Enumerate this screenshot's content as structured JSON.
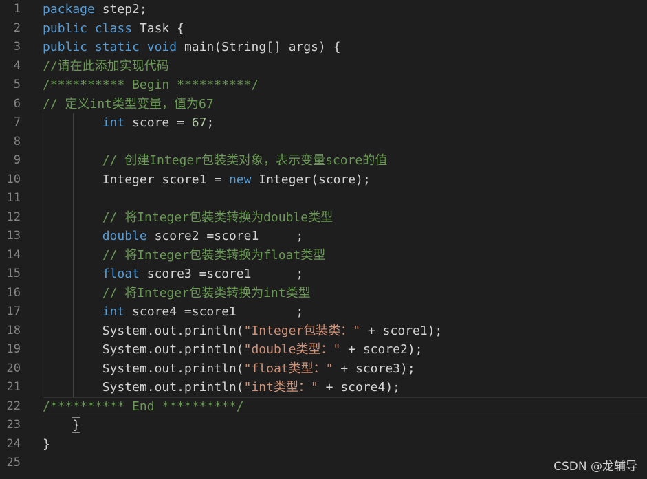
{
  "editor": {
    "lines": [
      {
        "n": "1",
        "segments": [
          {
            "t": "package",
            "c": "kw"
          },
          {
            "t": " step2;",
            "c": ""
          }
        ]
      },
      {
        "n": "2",
        "segments": [
          {
            "t": "public",
            "c": "kw"
          },
          {
            "t": " ",
            "c": ""
          },
          {
            "t": "class",
            "c": "kw"
          },
          {
            "t": " Task {",
            "c": ""
          }
        ]
      },
      {
        "n": "3",
        "segments": [
          {
            "t": "public",
            "c": "kw"
          },
          {
            "t": " ",
            "c": ""
          },
          {
            "t": "static",
            "c": "kw"
          },
          {
            "t": " ",
            "c": ""
          },
          {
            "t": "void",
            "c": "kw"
          },
          {
            "t": " main(String[] args) {",
            "c": ""
          }
        ]
      },
      {
        "n": "4",
        "segments": [
          {
            "t": "//请在此添加实现代码",
            "c": "cm"
          }
        ]
      },
      {
        "n": "5",
        "segments": [
          {
            "t": "/********** Begin **********/",
            "c": "cm"
          }
        ]
      },
      {
        "n": "6",
        "segments": [
          {
            "t": "// 定义int类型变量，值为67",
            "c": "cm"
          }
        ]
      },
      {
        "n": "7",
        "segments": [
          {
            "t": "        ",
            "c": ""
          },
          {
            "t": "int",
            "c": "kw"
          },
          {
            "t": " score = ",
            "c": ""
          },
          {
            "t": "67",
            "c": "num"
          },
          {
            "t": ";",
            "c": ""
          }
        ]
      },
      {
        "n": "8",
        "segments": []
      },
      {
        "n": "9",
        "segments": [
          {
            "t": "        ",
            "c": ""
          },
          {
            "t": "// 创建Integer包装类对象，表示变量score的值",
            "c": "cm"
          }
        ]
      },
      {
        "n": "10",
        "segments": [
          {
            "t": "        Integer score1 = ",
            "c": ""
          },
          {
            "t": "new",
            "c": "kw"
          },
          {
            "t": " Integer(score);",
            "c": ""
          }
        ]
      },
      {
        "n": "11",
        "segments": []
      },
      {
        "n": "12",
        "segments": [
          {
            "t": "        ",
            "c": ""
          },
          {
            "t": "// 将Integer包装类转换为double类型",
            "c": "cm"
          }
        ]
      },
      {
        "n": "13",
        "segments": [
          {
            "t": "        ",
            "c": ""
          },
          {
            "t": "double",
            "c": "kw"
          },
          {
            "t": " score2 =score1     ;",
            "c": ""
          }
        ]
      },
      {
        "n": "14",
        "segments": [
          {
            "t": "        ",
            "c": ""
          },
          {
            "t": "// 将Integer包装类转换为float类型",
            "c": "cm"
          }
        ]
      },
      {
        "n": "15",
        "segments": [
          {
            "t": "        ",
            "c": ""
          },
          {
            "t": "float",
            "c": "kw"
          },
          {
            "t": " score3 =score1      ;",
            "c": ""
          }
        ]
      },
      {
        "n": "16",
        "segments": [
          {
            "t": "        ",
            "c": ""
          },
          {
            "t": "// 将Integer包装类转换为int类型",
            "c": "cm"
          }
        ]
      },
      {
        "n": "17",
        "segments": [
          {
            "t": "        ",
            "c": ""
          },
          {
            "t": "int",
            "c": "kw"
          },
          {
            "t": " score4 =score1        ;",
            "c": ""
          }
        ]
      },
      {
        "n": "18",
        "segments": [
          {
            "t": "        System.out.println(",
            "c": ""
          },
          {
            "t": "\"Integer包装类：\"",
            "c": "str"
          },
          {
            "t": " + score1);",
            "c": ""
          }
        ]
      },
      {
        "n": "19",
        "segments": [
          {
            "t": "        System.out.println(",
            "c": ""
          },
          {
            "t": "\"double类型：\"",
            "c": "str"
          },
          {
            "t": " + score2);",
            "c": ""
          }
        ]
      },
      {
        "n": "20",
        "segments": [
          {
            "t": "        System.out.println(",
            "c": ""
          },
          {
            "t": "\"float类型：\"",
            "c": "str"
          },
          {
            "t": " + score3);",
            "c": ""
          }
        ]
      },
      {
        "n": "21",
        "segments": [
          {
            "t": "        System.out.println(",
            "c": ""
          },
          {
            "t": "\"int类型：\"",
            "c": "str"
          },
          {
            "t": " + score4);",
            "c": ""
          }
        ]
      },
      {
        "n": "22",
        "segments": [
          {
            "t": "/********** End **********/",
            "c": "cm"
          }
        ]
      },
      {
        "n": "23",
        "segments": [
          {
            "t": "    ",
            "c": ""
          },
          {
            "t": "}",
            "c": "brace"
          }
        ]
      },
      {
        "n": "24",
        "segments": [
          {
            "t": "}",
            "c": ""
          }
        ]
      },
      {
        "n": "25",
        "segments": []
      }
    ],
    "active_line": 22
  },
  "watermark": {
    "text": "CSDN @龙辅导"
  },
  "colors": {
    "background": "#1e1e1e",
    "keyword": "#569cd6",
    "comment": "#6a9955",
    "string": "#ce9178",
    "number": "#b5cea8",
    "line_number": "#858585"
  }
}
